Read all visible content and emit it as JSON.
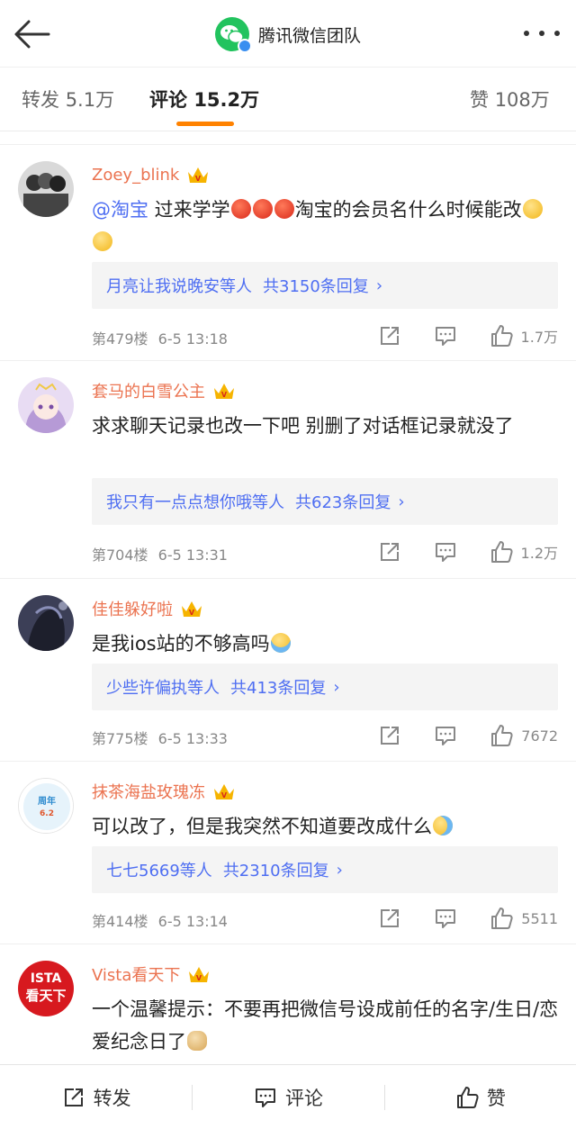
{
  "header": {
    "title": "腾讯微信团队"
  },
  "tabs": {
    "repost_label": "转发",
    "repost_count": "5.1万",
    "comment_label": "评论",
    "comment_count": "15.2万",
    "like_label": "赞",
    "like_count": "108万"
  },
  "comments": [
    {
      "user": "Zoey_blink",
      "mention": "@淘宝",
      "text_a": " 过来学学",
      "text_b": "淘宝的会员名什么时候能改",
      "reply_users": "月亮让我说晚安等人",
      "reply_count": "共3150条回复",
      "floor": "第479楼",
      "time": "6-5 13:18",
      "likes": "1.7万"
    },
    {
      "user": "套马的白雪公主",
      "text": "求求聊天记录也改一下吧 别删了对话框记录就没了",
      "reply_users": "我只有一点点想你哦等人",
      "reply_count": "共623条回复",
      "floor": "第704楼",
      "time": "6-5 13:31",
      "likes": "1.2万"
    },
    {
      "user": "佳佳躲好啦",
      "text": "是我ios站的不够高吗",
      "reply_users": "少些许偏执等人",
      "reply_count": "共413条回复",
      "floor": "第775楼",
      "time": "6-5 13:33",
      "likes": "7672"
    },
    {
      "user": "抹茶海盐玫瑰冻",
      "text": "可以改了，但是我突然不知道要改成什么",
      "avatar_text_top": "周年",
      "avatar_text_date": "6.2",
      "reply_users": "七七5669等人",
      "reply_count": "共2310条回复",
      "floor": "第414楼",
      "time": "6-5 13:14",
      "likes": "5511"
    },
    {
      "user": "Vista看天下",
      "avatar_text_top": "ISTA",
      "avatar_text_main": "看天下",
      "text": "一个温馨提示：不要再把微信号设成前任的名字/生日/恋爱纪念日了"
    }
  ],
  "bottom": {
    "repost": "转发",
    "comment": "评论",
    "like": "赞"
  },
  "colors": {
    "accent": "#ff8200",
    "username": "#eb7350",
    "link": "#4e6ef2",
    "wechat_green": "#22c35e"
  }
}
